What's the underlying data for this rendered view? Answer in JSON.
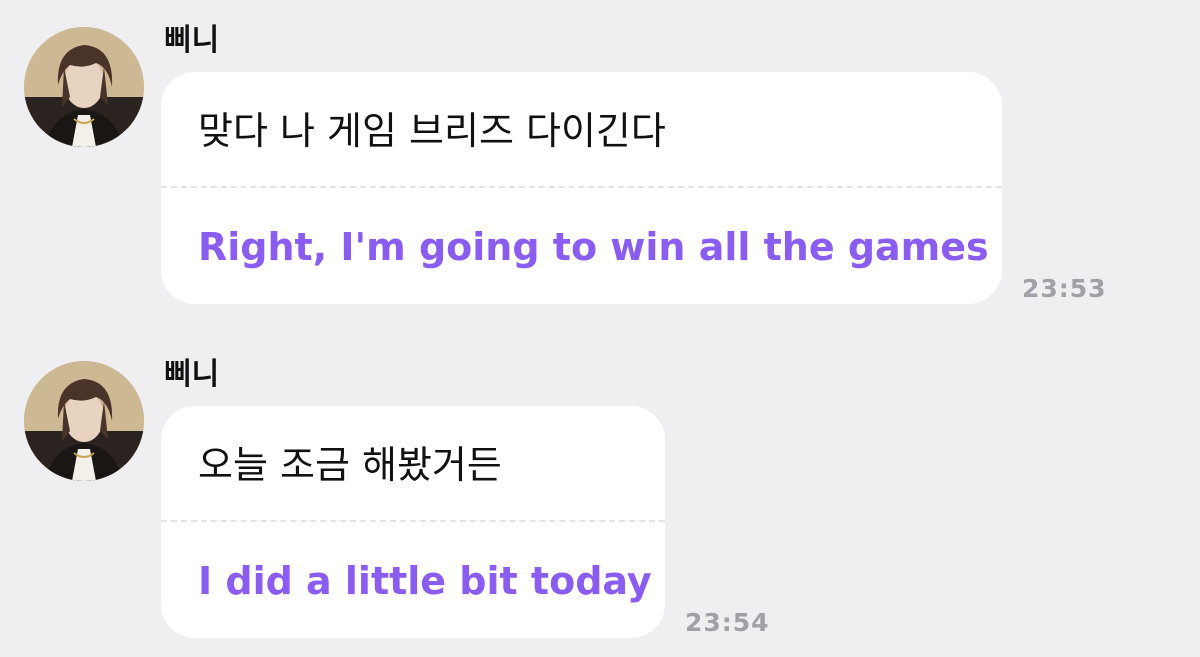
{
  "messages": [
    {
      "sender": "삐니",
      "avatar_icon": "profile-photo",
      "original": "맞다 나 게임 브리즈 다이긴다",
      "translation": "Right, I'm going to win all the games",
      "time": "23:53"
    },
    {
      "sender": "삐니",
      "avatar_icon": "profile-photo",
      "original": "오늘 조금 해봤거든",
      "translation": "I did a little bit today",
      "time": "23:54"
    }
  ],
  "colors": {
    "background": "#efeff1",
    "bubble": "#ffffff",
    "translation_text": "#8b5cf0",
    "timestamp": "#a0a0a6"
  }
}
